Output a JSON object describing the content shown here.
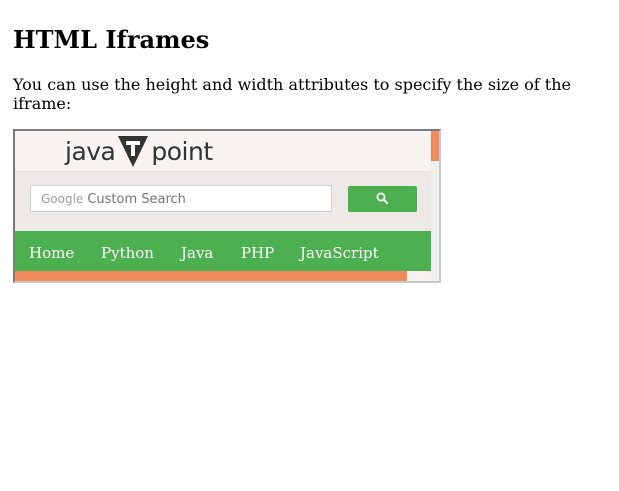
{
  "heading": "HTML Iframes",
  "description": "You can use the height and width attributes to specify the size of the iframe:",
  "iframe": {
    "logo_left": "java",
    "logo_mid": "T",
    "logo_right": "point",
    "search": {
      "google_label": "Google",
      "placeholder": "Custom Search",
      "button_icon": "search-icon"
    },
    "nav": [
      "Home",
      "Python",
      "Java",
      "PHP",
      "JavaScript"
    ],
    "colors": {
      "green": "#4caf50",
      "orange": "#ef8a5d"
    }
  }
}
